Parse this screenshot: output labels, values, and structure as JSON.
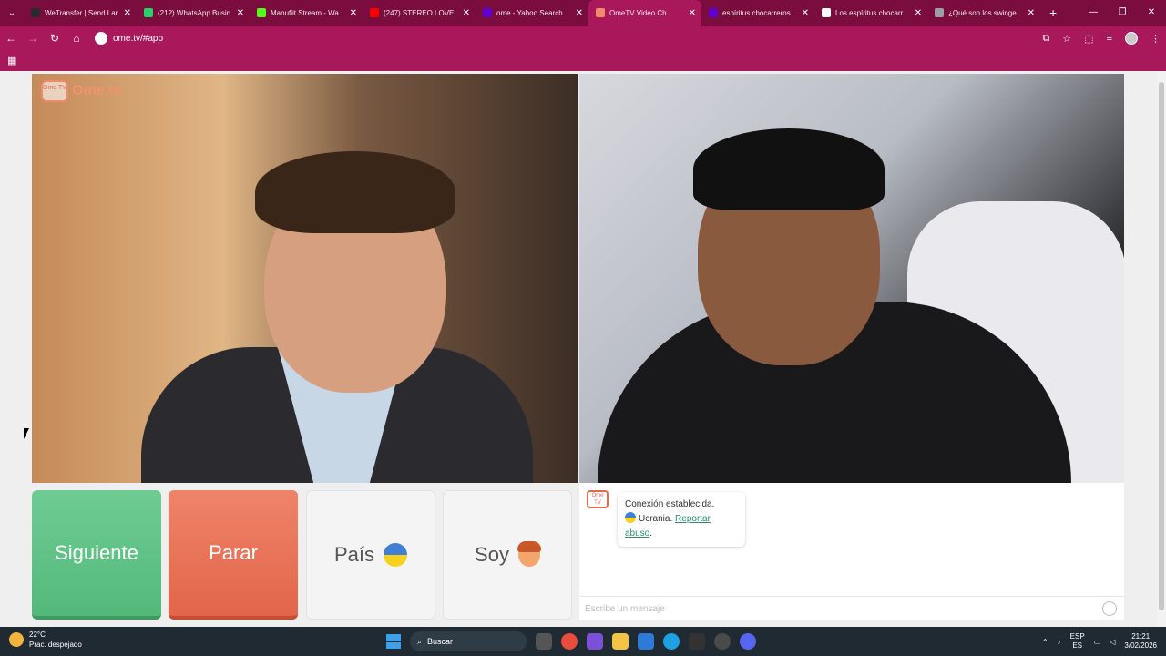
{
  "browser": {
    "tabs": [
      {
        "title": "WeTransfer | Send Lar",
        "color": "#2b2b2b",
        "active": false
      },
      {
        "title": "(212) WhatsApp Busin",
        "color": "#25d366",
        "active": false
      },
      {
        "title": "Manufiit Stream - Wa",
        "color": "#53fc18",
        "active": false
      },
      {
        "title": "(247) STEREO LOVE!",
        "color": "#ff0000",
        "active": false
      },
      {
        "title": "ome - Yahoo Search",
        "color": "#6001d2",
        "active": false
      },
      {
        "title": "OmeTV Video Ch",
        "color": "#f08a6c",
        "active": true
      },
      {
        "title": "espíritus chocarreros",
        "color": "#6001d2",
        "active": false
      },
      {
        "title": "Los espíritus chocarr",
        "color": "#ffffff",
        "active": false
      },
      {
        "title": "¿Qué son los swinge",
        "color": "#9aa0a6",
        "active": false
      }
    ],
    "url": "ome.tv/#app"
  },
  "site": {
    "logo_badge": "Ome TV",
    "logo_text": "Ome.tv"
  },
  "buttons": {
    "next": "Siguiente",
    "stop": "Parar",
    "country": "País",
    "gender": "Soy"
  },
  "chat": {
    "icon_label": "Ome TV",
    "connection": "Conexión establecida.",
    "country": "Ucrania.",
    "report": "Reportar abuso",
    "report_suffix": ".",
    "placeholder": "Escribe un mensaje"
  },
  "taskbar": {
    "temperature": "22°C",
    "weather": "Prac. despejado",
    "search": "Buscar",
    "lang_top": "ESP",
    "lang_bottom": "ES",
    "time": "21:21",
    "date": "3/02/2026"
  },
  "colors": {
    "chrome": "#a8185a",
    "next": "#5fc386",
    "stop": "#e8704f"
  }
}
